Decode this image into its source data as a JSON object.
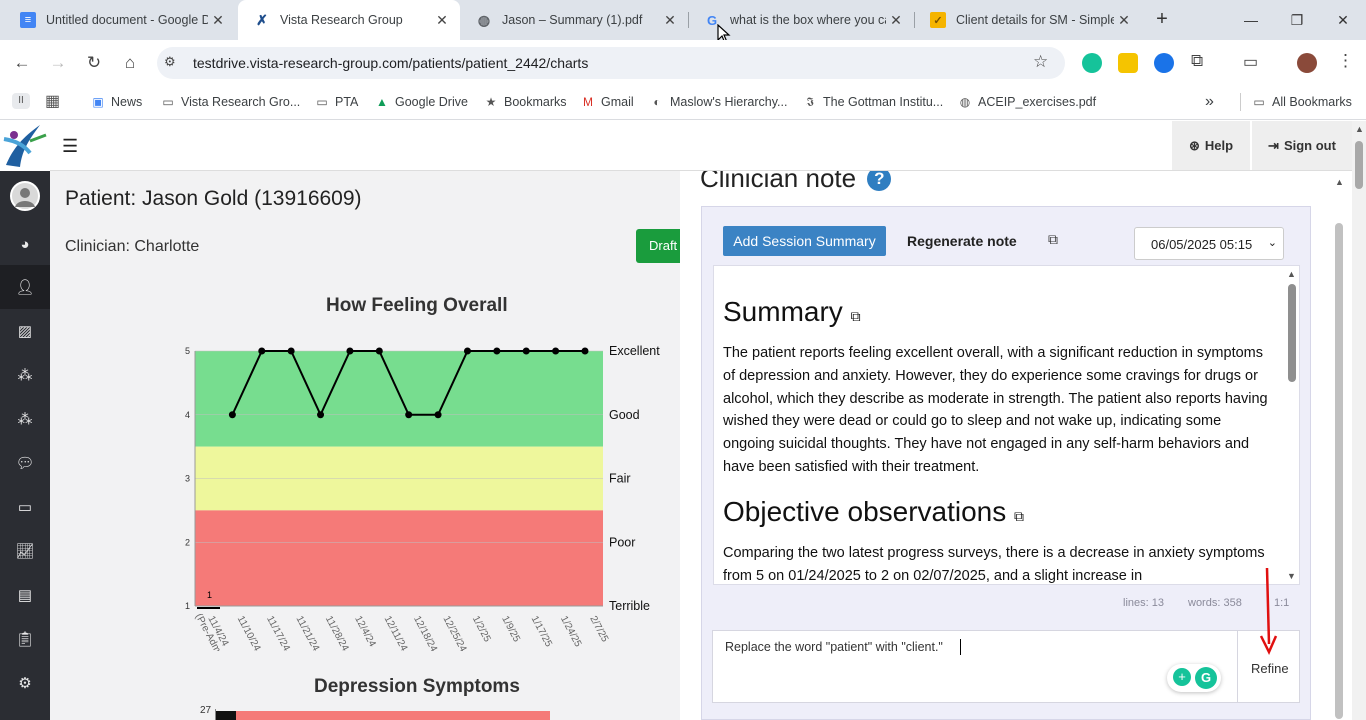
{
  "browser": {
    "tabs": [
      {
        "title": "Untitled document - Google Docs",
        "icon": "google-docs-icon",
        "color": "#4285f4"
      },
      {
        "title": "Vista Research Group",
        "icon": "vista-icon",
        "color": "#1f4e8c"
      },
      {
        "title": "Jason – Summary (1).pdf",
        "icon": "globe-icon",
        "color": "#5f6368"
      },
      {
        "title": "what is the box where you can",
        "icon": "google-icon",
        "color": "#4285f4"
      },
      {
        "title": "Client details for SM - SimplePractice",
        "icon": "simplepractice-icon",
        "color": "#f5b400"
      }
    ],
    "url": "testdrive.vista-research-group.com/patients/patient_2442/charts",
    "bookmarks": [
      "News",
      "Vista Research Gro...",
      "PTA",
      "Google Drive",
      "Bookmarks",
      "Gmail",
      "Maslow's Hierarchy...",
      "The Gottman Institu...",
      "ACEIP_exercises.pdf"
    ],
    "all_bookmarks": "All Bookmarks",
    "overflow": "»"
  },
  "header": {
    "help": "Help",
    "signout": "Sign out"
  },
  "patient": {
    "title": "Patient: Jason Gold (13916609)",
    "clinician": "Clinician: Charlotte",
    "draft_button": "Draft"
  },
  "chart_data": [
    {
      "type": "line",
      "title": "How Feeling Overall",
      "categories": [
        "11/4/24 (Pre-Adm.)",
        "11/10/24",
        "11/17/24",
        "11/21/24",
        "11/28/24",
        "12/4/24",
        "12/11/24",
        "12/18/24",
        "12/25/24",
        "1/2/25",
        "1/9/25",
        "1/17/25",
        "1/24/25",
        "2/7/25"
      ],
      "values": [
        4,
        5,
        5,
        4,
        5,
        5,
        4,
        4,
        5,
        5,
        5,
        5,
        5
      ],
      "ylim": [
        1,
        5
      ],
      "yticks": [
        1,
        2,
        3,
        4,
        5
      ],
      "bands": [
        {
          "label": "Excellent",
          "color": "#77dd8f"
        },
        {
          "label": "Good",
          "color": "#77dd8f"
        },
        {
          "label": "Fair",
          "color": "#eef79c"
        },
        {
          "label": "Poor",
          "color": "#f57a78"
        },
        {
          "label": "Terrible",
          "color": "#f57a78"
        }
      ],
      "annotation": "1"
    },
    {
      "type": "bar",
      "title": "Depression Symptoms",
      "ytick_top": "27"
    }
  ],
  "note": {
    "heading": "Clinician note",
    "add_session": "Add Session Summary",
    "regenerate": "Regenerate note",
    "date": "06/05/2025 05:15",
    "sections": [
      {
        "heading": "Summary",
        "body": "The patient reports feeling excellent overall, with a significant reduction in symptoms of depression and anxiety. However, they do experience some cravings for drugs or alcohol, which they describe as moderate in strength. The patient also reports having wished they were dead or could go to sleep and not wake up, indicating some ongoing suicidal thoughts. They have not engaged in any self-harm behaviors and have been satisfied with their treatment."
      },
      {
        "heading": "Objective observations",
        "body": "Comparing the two latest progress surveys, there is a decrease in anxiety symptoms from 5 on 01/24/2025 to 2 on 02/07/2025, and a slight increase in"
      }
    ],
    "lines": "lines: 13",
    "words": "words: 358",
    "position": "1:1",
    "refine_input": "Replace the word \"patient\" with \"client.\"",
    "refine_button": "Refine"
  }
}
